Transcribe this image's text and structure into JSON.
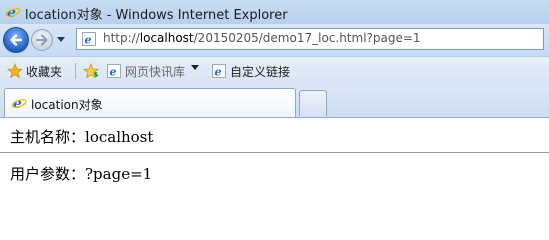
{
  "window": {
    "title": "location对象 - Windows Internet Explorer"
  },
  "navigation": {
    "address_prefix": "http://",
    "address_host": "localhost",
    "address_path": "/20150205/demo17_loc.html?page=1"
  },
  "favorites_bar": {
    "favorites_label": "收藏夹",
    "web_slice_label": "网页快讯库",
    "custom_links_label": "自定义链接"
  },
  "tabs": [
    {
      "label": "location对象"
    }
  ],
  "content": {
    "host_label": "主机名称：",
    "host_value": "localhost",
    "search_label": "用户参数：",
    "search_value": "?page=1"
  },
  "colors": {
    "titlebar": "#c9dcf3",
    "ie_blue": "#1f6fd1",
    "ie_ring": "#f5b800",
    "star": "#f2b51c"
  }
}
